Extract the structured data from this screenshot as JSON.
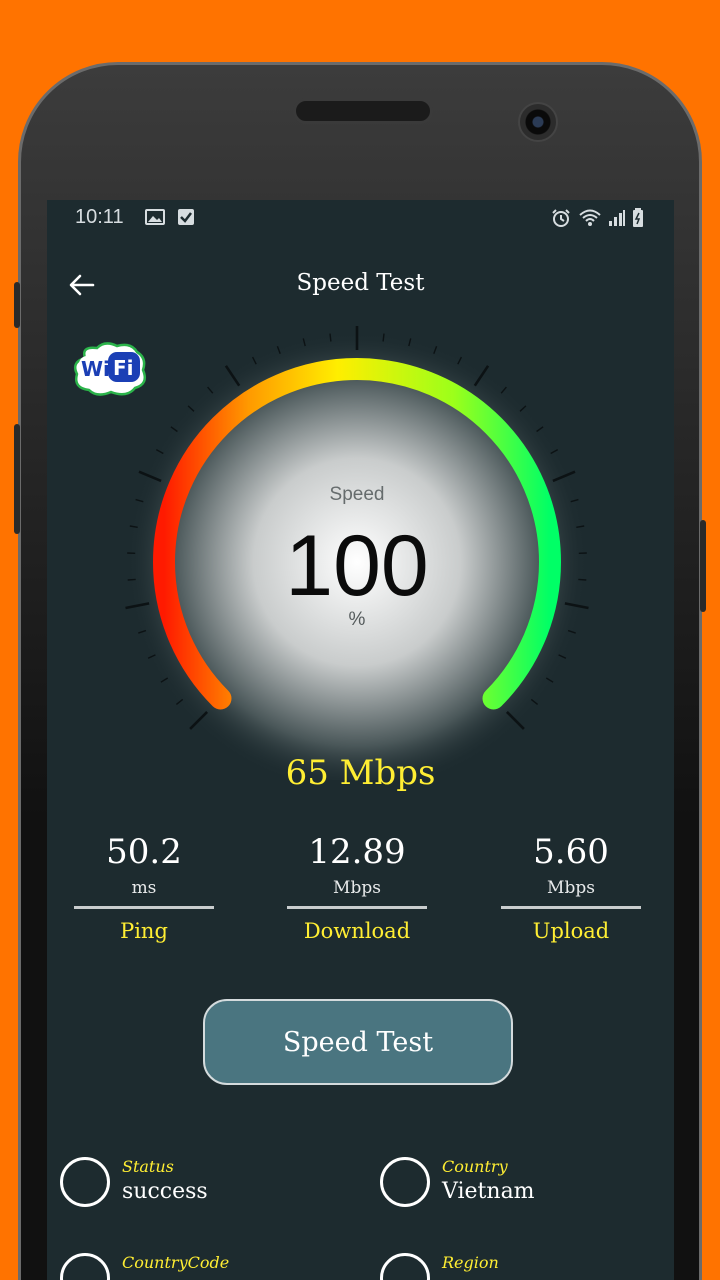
{
  "status_bar": {
    "time": "10:11",
    "left_icons": [
      "image-icon",
      "checkbox-icon"
    ],
    "right_icons": [
      "alarm-icon",
      "wifi-icon",
      "signal-icon",
      "battery-icon"
    ]
  },
  "app_bar": {
    "title": "Speed Test",
    "back_icon": "arrow-left-icon"
  },
  "logo": {
    "wi": "Wi",
    "fi": "Fi"
  },
  "gauge": {
    "label": "Speed",
    "value": "100",
    "unit": "%",
    "colors": [
      "#ff1a00",
      "#ff9a00",
      "#ffee00",
      "#9cff1a",
      "#00ff66"
    ]
  },
  "current_speed": "65 Mbps",
  "stats": [
    {
      "value": "50.2",
      "unit": "ms",
      "label": "Ping"
    },
    {
      "value": "12.89",
      "unit": "Mbps",
      "label": "Download"
    },
    {
      "value": "5.60",
      "unit": "Mbps",
      "label": "Upload"
    }
  ],
  "button": {
    "label": "Speed Test"
  },
  "info": [
    {
      "key": "Status",
      "value": "success"
    },
    {
      "key": "Country",
      "value": "Vietnam"
    },
    {
      "key": "CountryCode",
      "value": ""
    },
    {
      "key": "Region",
      "value": ""
    }
  ],
  "colors": {
    "background": "#ff7300",
    "screen": "#1d2b2f",
    "accent": "#ffee33",
    "button": "#4a7580"
  }
}
